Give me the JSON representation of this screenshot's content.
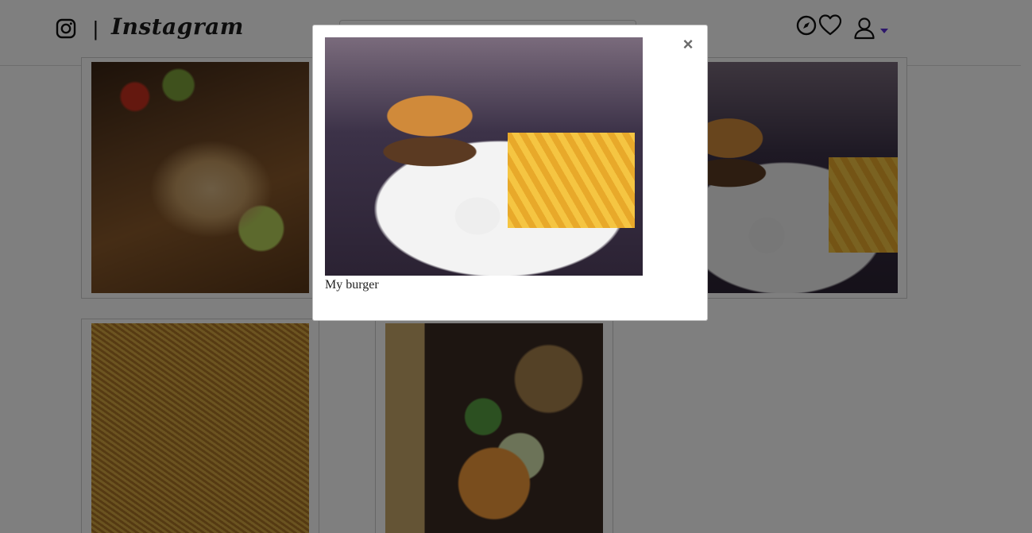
{
  "navbar": {
    "divider": "|",
    "brand": "Instagram",
    "search": {
      "value": "",
      "placeholder": ""
    },
    "accent_color": "#5b2fd6"
  },
  "feed": {
    "posts": [
      {
        "photo": "burrito"
      },
      {
        "photo": "burger"
      },
      {
        "photo": "noodles"
      },
      {
        "photo": "papaya-salad"
      }
    ]
  },
  "modal": {
    "close_label": "×",
    "caption": "My burger",
    "photo": "burger",
    "backdrop_color": "rgba(0,0,0,0.5)"
  },
  "icons": {
    "navbar": [
      "instagram-icon",
      "compass-icon",
      "heart-icon",
      "user-icon",
      "caret-down-icon"
    ],
    "modal": [
      "close-icon"
    ]
  }
}
